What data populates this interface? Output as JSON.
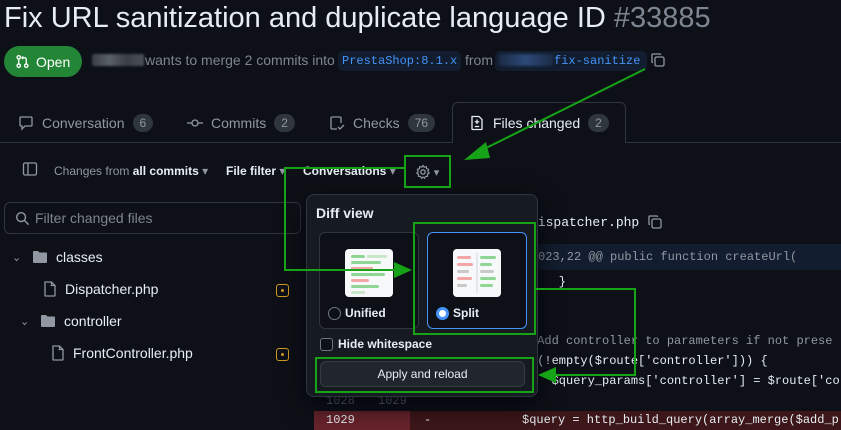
{
  "pr": {
    "title": "Fix URL sanitization and duplicate language ID",
    "number": "#33885",
    "status": "Open",
    "merge_text": "wants to merge 2 commits into",
    "base_branch": "PrestaShop:8.1.x",
    "from_text": "from",
    "head_branch": "fix-sanitize"
  },
  "tabs": [
    {
      "label": "Conversation",
      "count": "6"
    },
    {
      "label": "Commits",
      "count": "2"
    },
    {
      "label": "Checks",
      "count": "76"
    },
    {
      "label": "Files changed",
      "count": "2"
    }
  ],
  "toolbar": {
    "changes_prefix": "Changes from",
    "changes_bold": "all commits",
    "file_filter": "File filter",
    "conversations": "Conversations"
  },
  "file_tree": {
    "filter_placeholder": "Filter changed files",
    "items": [
      {
        "label": "classes",
        "type": "folder"
      },
      {
        "label": "Dispatcher.php",
        "type": "file"
      },
      {
        "label": "controller",
        "type": "folder"
      },
      {
        "label": "FrontController.php",
        "type": "file"
      }
    ]
  },
  "diff": {
    "file_name": "Dispatcher.php",
    "hunk": "023,22 @@ public function createUrl(",
    "lines": [
      {
        "text": "    }",
        "kind": "context"
      },
      {
        "text": "",
        "kind": "context"
      },
      {
        "text": "",
        "kind": "context"
      },
      {
        "text": " Add controller to parameters if not prese",
        "kind": "comment"
      },
      {
        "text": " (!empty($route['controller'])) {",
        "kind": "context"
      },
      {
        "text": "   $query_params['controller'] = $route['co",
        "kind": "context"
      },
      {
        "text": "",
        "kind": "context"
      },
      {
        "text": "$query = http_build_query(array_merge($add_p",
        "kind": "deleted"
      }
    ],
    "gutter_context": {
      "old": "1028",
      "new": "1029"
    },
    "gutter_deleted": {
      "old": "1029",
      "sign": "-"
    }
  },
  "diff_view": {
    "title": "Diff view",
    "options": [
      {
        "label": "Unified",
        "selected": false
      },
      {
        "label": "Split",
        "selected": true
      }
    ],
    "hide_whitespace": "Hide whitespace",
    "apply_button": "Apply and reload"
  },
  "colors": {
    "open_green": "#238636",
    "accent_blue": "#4493f8",
    "annotation_green": "#17a317",
    "deleted_bg": "#3c1618",
    "hunk_bg": "#121d2f"
  }
}
